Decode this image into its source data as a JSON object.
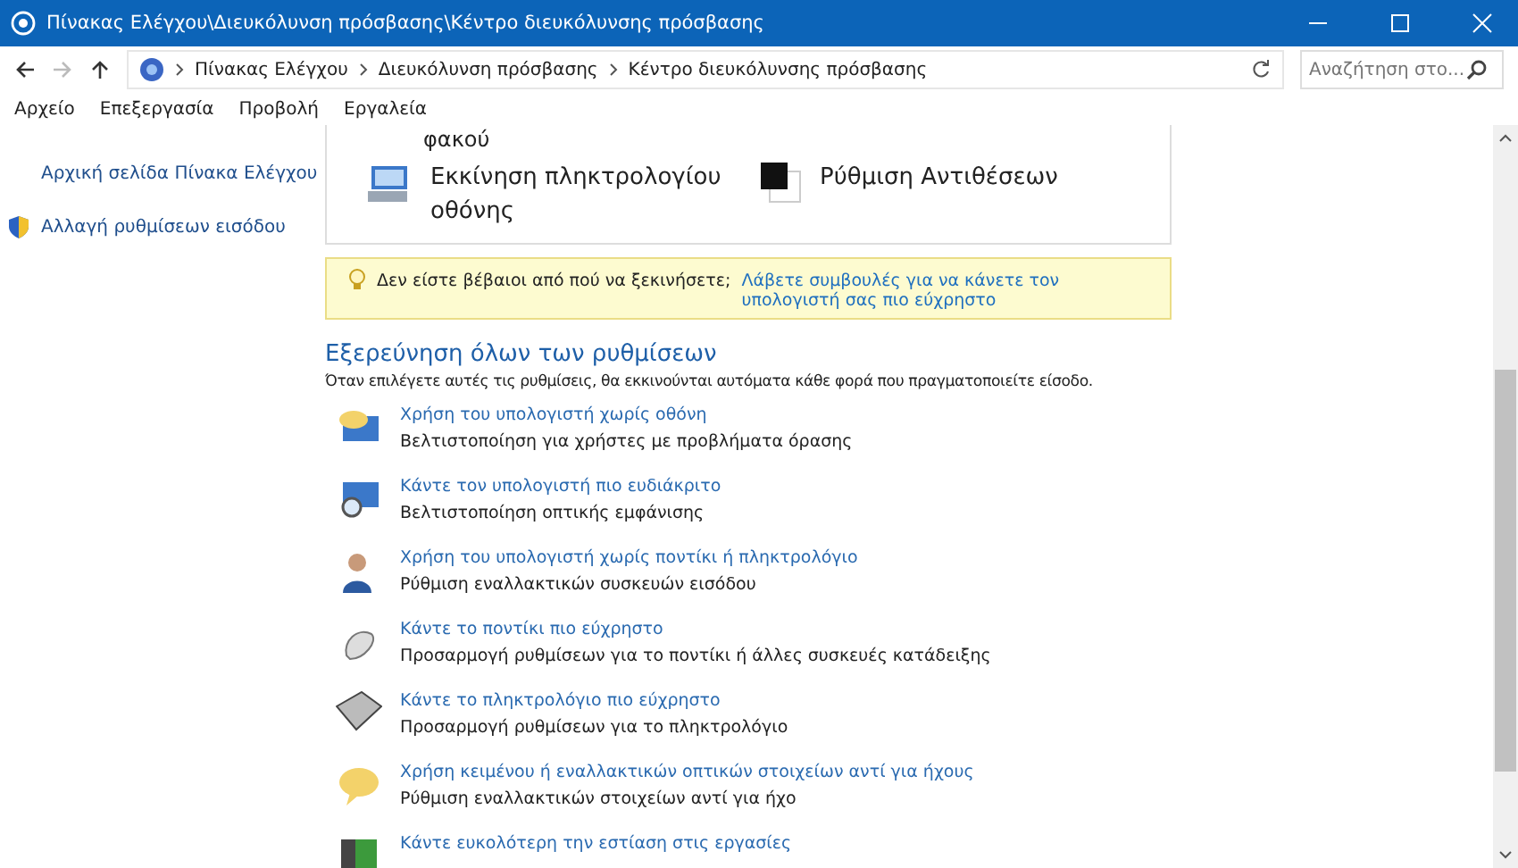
{
  "window": {
    "title": "Πίνακας Ελέγχου\\Διευκόλυνση πρόσβασης\\Κέντρο διευκόλυνσης πρόσβασης"
  },
  "address_bar": {
    "path": [
      "Πίνακας Ελέγχου",
      "Διευκόλυνση πρόσβασης",
      "Κέντρο διευκόλυνσης πρόσβασης"
    ],
    "search_placeholder": "Αναζήτηση στο..."
  },
  "menu": [
    "Αρχείο",
    "Επεξεργασία",
    "Προβολή",
    "Εργαλεία"
  ],
  "sidebar": {
    "items": [
      "Αρχική σελίδα Πίνακα Ελέγχου",
      "Αλλαγή ρυθμίσεων εισόδου"
    ]
  },
  "quick_tools": {
    "cut_label": "φακού",
    "items": [
      "Εκκίνηση πληκτρολογίου οθόνης",
      "Ρύθμιση Αντιθέσεων"
    ]
  },
  "tip": {
    "text": "Δεν είστε βέβαιοι από πού να ξεκινήσετε;",
    "link": "Λάβετε συμβουλές για να κάνετε τον υπολογιστή σας πιο εύχρηστο"
  },
  "explore": {
    "heading": "Εξερεύνηση όλων των ρυθμίσεων",
    "description": "Όταν επιλέγετε αυτές τις ρυθμίσεις, θα εκκινούνται αυτόματα κάθε φορά που πραγματοποιείτε είσοδο.",
    "items": [
      {
        "title": "Χρήση του υπολογιστή χωρίς οθόνη",
        "description": "Βελτιστοποίηση για χρήστες με προβλήματα όρασης"
      },
      {
        "title": "Κάντε τον υπολογιστή πιο ευδιάκριτο",
        "description": "Βελτιστοποίηση οπτικής εμφάνισης"
      },
      {
        "title": "Χρήση του υπολογιστή χωρίς ποντίκι ή πληκτρολόγιο",
        "description": "Ρύθμιση εναλλακτικών συσκευών εισόδου"
      },
      {
        "title": "Κάντε το ποντίκι πιο εύχρηστο",
        "description": "Προσαρμογή ρυθμίσεων για το ποντίκι ή άλλες συσκευές κατάδειξης"
      },
      {
        "title": "Κάντε το πληκτρολόγιο πιο εύχρηστο",
        "description": "Προσαρμογή ρυθμίσεων για το πληκτρολόγιο"
      },
      {
        "title": "Χρήση κειμένου ή εναλλακτικών οπτικών στοιχείων αντί για ήχους",
        "description": "Ρύθμιση εναλλακτικών στοιχείων αντί για ήχο"
      },
      {
        "title": "Κάντε ευκολότερη την εστίαση στις εργασίες"
      }
    ]
  }
}
